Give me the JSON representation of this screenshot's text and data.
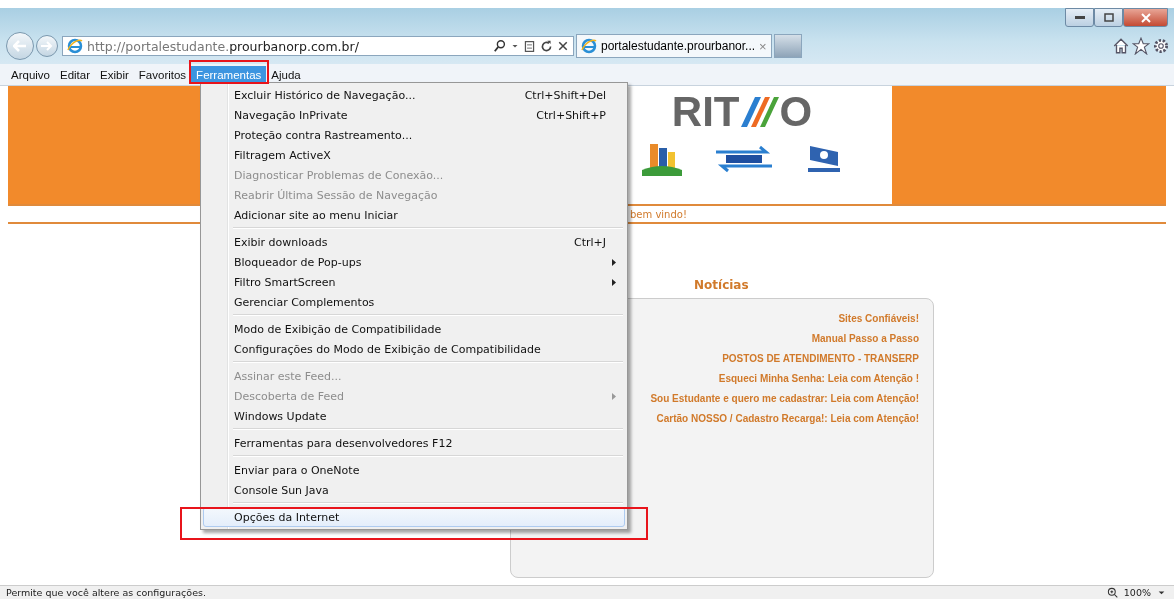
{
  "address_bar": {
    "url_prefix": "http://portalestudante.",
    "url_domain": "prourbanorp.com.br/"
  },
  "tabs": [
    {
      "label": "portalestudante.prourbanor...",
      "selected": true,
      "close": "×"
    }
  ],
  "menu_bar": [
    {
      "label": "Arquivo",
      "selected": false
    },
    {
      "label": "Editar",
      "selected": false
    },
    {
      "label": "Exibir",
      "selected": false
    },
    {
      "label": "Favoritos",
      "selected": false
    },
    {
      "label": "Ferramentas",
      "selected": true
    },
    {
      "label": "Ajuda",
      "selected": false
    }
  ],
  "tools_menu": [
    {
      "kind": "item",
      "label": "Excluir Histórico de Navegação...",
      "shortcut": "Ctrl+Shift+Del",
      "disabled": false,
      "submenu": false,
      "selected": false
    },
    {
      "kind": "item",
      "label": "Navegação InPrivate",
      "shortcut": "Ctrl+Shift+P",
      "disabled": false,
      "submenu": false,
      "selected": false
    },
    {
      "kind": "item",
      "label": "Proteção contra Rastreamento...",
      "disabled": false,
      "submenu": false,
      "selected": false
    },
    {
      "kind": "item",
      "label": "Filtragem ActiveX",
      "disabled": false,
      "submenu": false,
      "selected": false
    },
    {
      "kind": "item",
      "label": "Diagnosticar Problemas de Conexão...",
      "disabled": true,
      "submenu": false,
      "selected": false
    },
    {
      "kind": "item",
      "label": "Reabrir Última Sessão de Navegação",
      "disabled": true,
      "submenu": false,
      "selected": false
    },
    {
      "kind": "item",
      "label": "Adicionar site ao menu Iniciar",
      "disabled": false,
      "submenu": false,
      "selected": false
    },
    {
      "kind": "separator"
    },
    {
      "kind": "item",
      "label": "Exibir downloads",
      "shortcut": "Ctrl+J",
      "disabled": false,
      "submenu": false,
      "selected": false
    },
    {
      "kind": "item",
      "label": "Bloqueador de Pop-ups",
      "disabled": false,
      "submenu": true,
      "selected": false
    },
    {
      "kind": "item",
      "label": "Filtro SmartScreen",
      "disabled": false,
      "submenu": true,
      "selected": false
    },
    {
      "kind": "item",
      "label": "Gerenciar Complementos",
      "disabled": false,
      "submenu": false,
      "selected": false
    },
    {
      "kind": "separator"
    },
    {
      "kind": "item",
      "label": "Modo de Exibição de Compatibilidade",
      "disabled": false,
      "submenu": false,
      "selected": false
    },
    {
      "kind": "item",
      "label": "Configurações do Modo de Exibição de Compatibilidade",
      "disabled": false,
      "submenu": false,
      "selected": false
    },
    {
      "kind": "separator"
    },
    {
      "kind": "item",
      "label": "Assinar este Feed...",
      "disabled": true,
      "submenu": false,
      "selected": false
    },
    {
      "kind": "item",
      "label": "Descoberta de Feed",
      "disabled": true,
      "submenu": true,
      "selected": false
    },
    {
      "kind": "item",
      "label": "Windows Update",
      "disabled": false,
      "submenu": false,
      "selected": false
    },
    {
      "kind": "separator"
    },
    {
      "kind": "item",
      "label": "Ferramentas para desenvolvedores F12",
      "disabled": false,
      "submenu": false,
      "selected": false
    },
    {
      "kind": "separator"
    },
    {
      "kind": "item",
      "label": "Enviar para o OneNote",
      "disabled": false,
      "submenu": false,
      "selected": false
    },
    {
      "kind": "item",
      "label": "Console Sun Java",
      "disabled": false,
      "submenu": false,
      "selected": false
    },
    {
      "kind": "separator"
    },
    {
      "kind": "item",
      "label": "Opções da Internet",
      "disabled": false,
      "submenu": false,
      "selected": true
    }
  ],
  "page": {
    "logo_left": "RIT",
    "logo_right": "O",
    "welcome": "bem vindo!",
    "news_title": "Notícias",
    "news": [
      "Sites Confiáveis!",
      "Manual Passo a Passo",
      "POSTOS DE ATENDIMENTO - TRANSERP",
      "Esqueci Minha Senha: Leia com Atenção !",
      "Sou Estudante e quero me cadastrar: Leia com Atenção!",
      "Cartão NOSSO / Cadastro Recarga!: Leia com Atenção!"
    ]
  },
  "status_bar": {
    "text": "Permite que você altere as configurações.",
    "zoom": "100%"
  }
}
